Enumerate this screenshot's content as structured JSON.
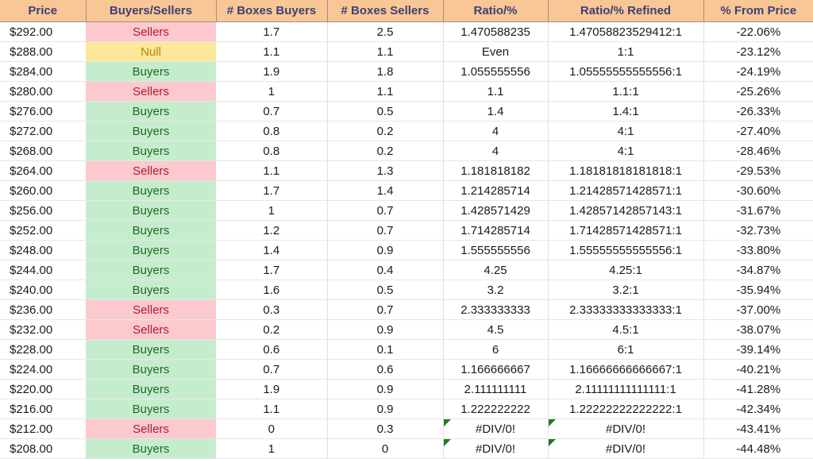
{
  "table": {
    "columns": [
      {
        "key": "price",
        "label": "Price"
      },
      {
        "key": "side",
        "label": "Buyers/Sellers"
      },
      {
        "key": "boxbuy",
        "label": "# Boxes Buyers"
      },
      {
        "key": "boxsell",
        "label": "# Boxes Sellers"
      },
      {
        "key": "ratio",
        "label": "Ratio/%"
      },
      {
        "key": "ratioref",
        "label": "Ratio/% Refined"
      },
      {
        "key": "pct",
        "label": "% From Price"
      }
    ],
    "colors": {
      "header_bg": "#f8c795",
      "header_text": "#3f3f76",
      "buyers_bg": "#c6ecce",
      "buyers_text": "#1d6b20",
      "sellers_bg": "#fcc9ce",
      "sellers_text": "#b01b32",
      "null_bg": "#fce79a",
      "null_text": "#b8860b",
      "error_flag": "#217a21"
    },
    "rows": [
      {
        "price": "$292.00",
        "side": "Sellers",
        "side_state": "sellers",
        "boxbuy": "1.7",
        "boxsell": "2.5",
        "ratio": "1.470588235",
        "ratioref": "1.47058823529412:1",
        "pct": "-22.06%",
        "error": false
      },
      {
        "price": "$288.00",
        "side": "Null",
        "side_state": "null",
        "boxbuy": "1.1",
        "boxsell": "1.1",
        "ratio": "Even",
        "ratioref": "1:1",
        "pct": "-23.12%",
        "error": false
      },
      {
        "price": "$284.00",
        "side": "Buyers",
        "side_state": "buyers",
        "boxbuy": "1.9",
        "boxsell": "1.8",
        "ratio": "1.055555556",
        "ratioref": "1.05555555555556:1",
        "pct": "-24.19%",
        "error": false
      },
      {
        "price": "$280.00",
        "side": "Sellers",
        "side_state": "sellers",
        "boxbuy": "1",
        "boxsell": "1.1",
        "ratio": "1.1",
        "ratioref": "1.1:1",
        "pct": "-25.26%",
        "error": false
      },
      {
        "price": "$276.00",
        "side": "Buyers",
        "side_state": "buyers",
        "boxbuy": "0.7",
        "boxsell": "0.5",
        "ratio": "1.4",
        "ratioref": "1.4:1",
        "pct": "-26.33%",
        "error": false
      },
      {
        "price": "$272.00",
        "side": "Buyers",
        "side_state": "buyers",
        "boxbuy": "0.8",
        "boxsell": "0.2",
        "ratio": "4",
        "ratioref": "4:1",
        "pct": "-27.40%",
        "error": false
      },
      {
        "price": "$268.00",
        "side": "Buyers",
        "side_state": "buyers",
        "boxbuy": "0.8",
        "boxsell": "0.2",
        "ratio": "4",
        "ratioref": "4:1",
        "pct": "-28.46%",
        "error": false
      },
      {
        "price": "$264.00",
        "side": "Sellers",
        "side_state": "sellers",
        "boxbuy": "1.1",
        "boxsell": "1.3",
        "ratio": "1.181818182",
        "ratioref": "1.18181818181818:1",
        "pct": "-29.53%",
        "error": false
      },
      {
        "price": "$260.00",
        "side": "Buyers",
        "side_state": "buyers",
        "boxbuy": "1.7",
        "boxsell": "1.4",
        "ratio": "1.214285714",
        "ratioref": "1.21428571428571:1",
        "pct": "-30.60%",
        "error": false
      },
      {
        "price": "$256.00",
        "side": "Buyers",
        "side_state": "buyers",
        "boxbuy": "1",
        "boxsell": "0.7",
        "ratio": "1.428571429",
        "ratioref": "1.42857142857143:1",
        "pct": "-31.67%",
        "error": false
      },
      {
        "price": "$252.00",
        "side": "Buyers",
        "side_state": "buyers",
        "boxbuy": "1.2",
        "boxsell": "0.7",
        "ratio": "1.714285714",
        "ratioref": "1.71428571428571:1",
        "pct": "-32.73%",
        "error": false
      },
      {
        "price": "$248.00",
        "side": "Buyers",
        "side_state": "buyers",
        "boxbuy": "1.4",
        "boxsell": "0.9",
        "ratio": "1.555555556",
        "ratioref": "1.55555555555556:1",
        "pct": "-33.80%",
        "error": false
      },
      {
        "price": "$244.00",
        "side": "Buyers",
        "side_state": "buyers",
        "boxbuy": "1.7",
        "boxsell": "0.4",
        "ratio": "4.25",
        "ratioref": "4.25:1",
        "pct": "-34.87%",
        "error": false
      },
      {
        "price": "$240.00",
        "side": "Buyers",
        "side_state": "buyers",
        "boxbuy": "1.6",
        "boxsell": "0.5",
        "ratio": "3.2",
        "ratioref": "3.2:1",
        "pct": "-35.94%",
        "error": false
      },
      {
        "price": "$236.00",
        "side": "Sellers",
        "side_state": "sellers",
        "boxbuy": "0.3",
        "boxsell": "0.7",
        "ratio": "2.333333333",
        "ratioref": "2.33333333333333:1",
        "pct": "-37.00%",
        "error": false
      },
      {
        "price": "$232.00",
        "side": "Sellers",
        "side_state": "sellers",
        "boxbuy": "0.2",
        "boxsell": "0.9",
        "ratio": "4.5",
        "ratioref": "4.5:1",
        "pct": "-38.07%",
        "error": false
      },
      {
        "price": "$228.00",
        "side": "Buyers",
        "side_state": "buyers",
        "boxbuy": "0.6",
        "boxsell": "0.1",
        "ratio": "6",
        "ratioref": "6:1",
        "pct": "-39.14%",
        "error": false
      },
      {
        "price": "$224.00",
        "side": "Buyers",
        "side_state": "buyers",
        "boxbuy": "0.7",
        "boxsell": "0.6",
        "ratio": "1.166666667",
        "ratioref": "1.16666666666667:1",
        "pct": "-40.21%",
        "error": false
      },
      {
        "price": "$220.00",
        "side": "Buyers",
        "side_state": "buyers",
        "boxbuy": "1.9",
        "boxsell": "0.9",
        "ratio": "2.111111111",
        "ratioref": "2.11111111111111:1",
        "pct": "-41.28%",
        "error": false
      },
      {
        "price": "$216.00",
        "side": "Buyers",
        "side_state": "buyers",
        "boxbuy": "1.1",
        "boxsell": "0.9",
        "ratio": "1.222222222",
        "ratioref": "1.22222222222222:1",
        "pct": "-42.34%",
        "error": false
      },
      {
        "price": "$212.00",
        "side": "Sellers",
        "side_state": "sellers",
        "boxbuy": "0",
        "boxsell": "0.3",
        "ratio": "#DIV/0!",
        "ratioref": "#DIV/0!",
        "pct": "-43.41%",
        "error": true
      },
      {
        "price": "$208.00",
        "side": "Buyers",
        "side_state": "buyers",
        "boxbuy": "1",
        "boxsell": "0",
        "ratio": "#DIV/0!",
        "ratioref": "#DIV/0!",
        "pct": "-44.48%",
        "error": true
      }
    ]
  }
}
